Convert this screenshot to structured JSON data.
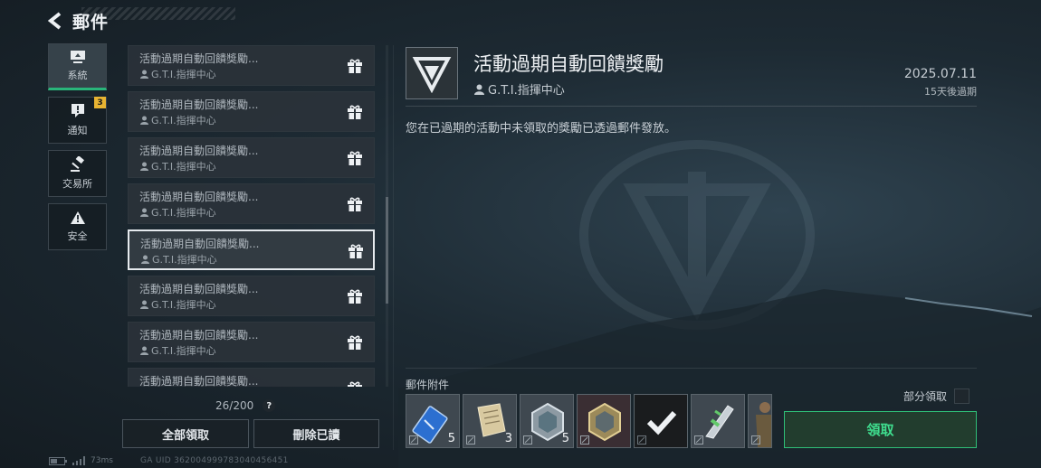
{
  "header": {
    "title": "郵件"
  },
  "categories": [
    {
      "label": "系統",
      "icon": "system-icon"
    },
    {
      "label": "通知",
      "icon": "notice-icon",
      "badge": "3"
    },
    {
      "label": "交易所",
      "icon": "gavel-icon"
    },
    {
      "label": "安全",
      "icon": "warning-icon"
    }
  ],
  "mails": [
    {
      "subject": "活動過期自動回饋獎勵...",
      "sender": "G.T.I.指揮中心"
    },
    {
      "subject": "活動過期自動回饋獎勵...",
      "sender": "G.T.I.指揮中心"
    },
    {
      "subject": "活動過期自動回饋獎勵...",
      "sender": "G.T.I.指揮中心"
    },
    {
      "subject": "活動過期自動回饋獎勵...",
      "sender": "G.T.I.指揮中心"
    },
    {
      "subject": "活動過期自動回饋獎勵...",
      "sender": "G.T.I.指揮中心"
    },
    {
      "subject": "活動過期自動回饋獎勵...",
      "sender": "G.T.I.指揮中心"
    },
    {
      "subject": "活動過期自動回饋獎勵...",
      "sender": "G.T.I.指揮中心"
    },
    {
      "subject": "活動過期自動回饋獎勵...",
      "sender": "G.T.I.指揮中心"
    }
  ],
  "list_footer": {
    "count": "26/200",
    "help": "?",
    "claim_all": "全部領取",
    "delete_read": "刪除已讀"
  },
  "status": {
    "ping": "73ms",
    "uid": "GA UID 362004999783040456451"
  },
  "detail": {
    "title": "活動過期自動回饋獎勵",
    "sender": "G.T.I.指揮中心",
    "date": "2025.07.11",
    "expire": "15天後過期",
    "body": "您在已過期的活動中未領取的獎勵已透過郵件發放。",
    "attachments_label": "郵件附件",
    "partial_claim_label": "部分領取",
    "claim_button": "領取"
  },
  "attachments": [
    {
      "name": "blue-ticket-item",
      "qty": "5"
    },
    {
      "name": "paper-scroll-item",
      "qty": "3"
    },
    {
      "name": "silver-hex-badge-item",
      "qty": "5"
    },
    {
      "name": "gold-hex-badge-item",
      "qty": ""
    },
    {
      "name": "checkmark-item",
      "qty": ""
    },
    {
      "name": "knife-item",
      "qty": ""
    },
    {
      "name": "soldier-item",
      "qty": ""
    }
  ],
  "colors": {
    "accent_green": "#2fbf78",
    "badge_yellow": "#e8b432"
  }
}
